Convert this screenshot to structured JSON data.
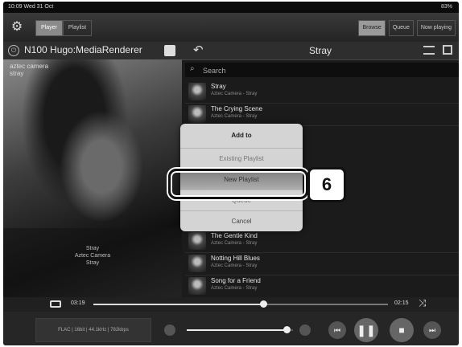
{
  "status_bar": {
    "time": "10:09 Wed 31 Oct",
    "battery": "83%"
  },
  "toolbar": {
    "settings_icon": "gear-icon",
    "mode_tabs": [
      {
        "label": "Player",
        "active": true
      },
      {
        "label": "Playlist",
        "active": false
      }
    ],
    "view_tabs": [
      {
        "label": "Browse",
        "active": true
      },
      {
        "label": "Queue",
        "active": false
      },
      {
        "label": "Now playing",
        "active": false
      }
    ]
  },
  "device": {
    "name": "N100 Hugo:MediaRenderer"
  },
  "header": {
    "title": "Stray"
  },
  "album": {
    "artist_line": "aztec camera",
    "album_line": "stray"
  },
  "now_playing": {
    "track": "Stray",
    "artist": "Aztec Camera",
    "album": "Stray"
  },
  "search": {
    "placeholder": "Search"
  },
  "tracks_top": [
    {
      "title": "Stray",
      "subtitle": "Aztec Camera - Stray"
    },
    {
      "title": "The Crying Scene",
      "subtitle": "Aztec Camera - Stray"
    }
  ],
  "tracks_bottom": [
    {
      "title": "The Gentle Kind",
      "subtitle": "Aztec Camera - Stray"
    },
    {
      "title": "Notting Hill Blues",
      "subtitle": "Aztec Camera - Stray"
    },
    {
      "title": "Song for a Friend",
      "subtitle": "Aztec Camera - Stray"
    }
  ],
  "popup": {
    "title": "Add to",
    "items": [
      "Existing Playlist",
      "New Playlist",
      "Queue",
      "Cancel"
    ]
  },
  "callout": {
    "number": "6"
  },
  "player": {
    "elapsed": "03:19",
    "remaining": "02:15",
    "progress_fraction": 0.58,
    "volume_fraction": 0.95,
    "format": "FLAC | 16bit | 44.1kHz | 782kbps"
  }
}
